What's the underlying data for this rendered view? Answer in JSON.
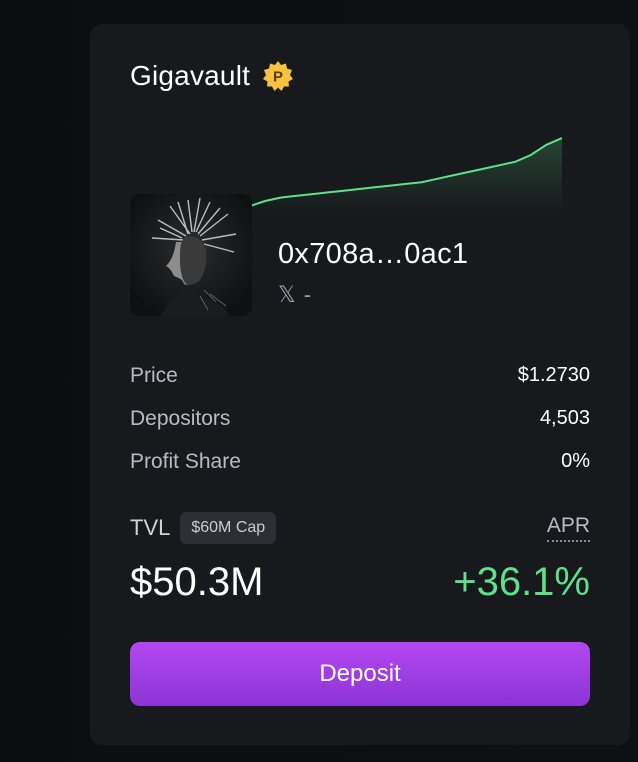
{
  "vault": {
    "name": "Gigavault",
    "badge_icon": "p-badge-icon",
    "badge_letter": "P",
    "badge_color": "#f5c242",
    "address": "0x708a…0ac1",
    "social_icon": "x-logo-icon",
    "social_glyph": "𝕏",
    "social_handle": "-"
  },
  "stats": [
    {
      "label": "Price",
      "value": "$1.2730"
    },
    {
      "label": "Depositors",
      "value": "4,503"
    },
    {
      "label": "Profit Share",
      "value": "0%"
    }
  ],
  "tvl": {
    "label": "TVL",
    "cap": "$60M Cap",
    "value": "$50.3M"
  },
  "apr": {
    "label": "APR",
    "value": "+36.1%",
    "color": "#5ee08c"
  },
  "deposit_button": {
    "label": "Deposit"
  },
  "sparkline": {
    "color": "#5ee08c",
    "values": [
      1.0,
      1.03,
      1.05,
      1.06,
      1.07,
      1.08,
      1.09,
      1.1,
      1.11,
      1.12,
      1.13,
      1.14,
      1.16,
      1.18,
      1.2,
      1.22,
      1.24,
      1.26,
      1.3,
      1.36,
      1.4
    ]
  }
}
